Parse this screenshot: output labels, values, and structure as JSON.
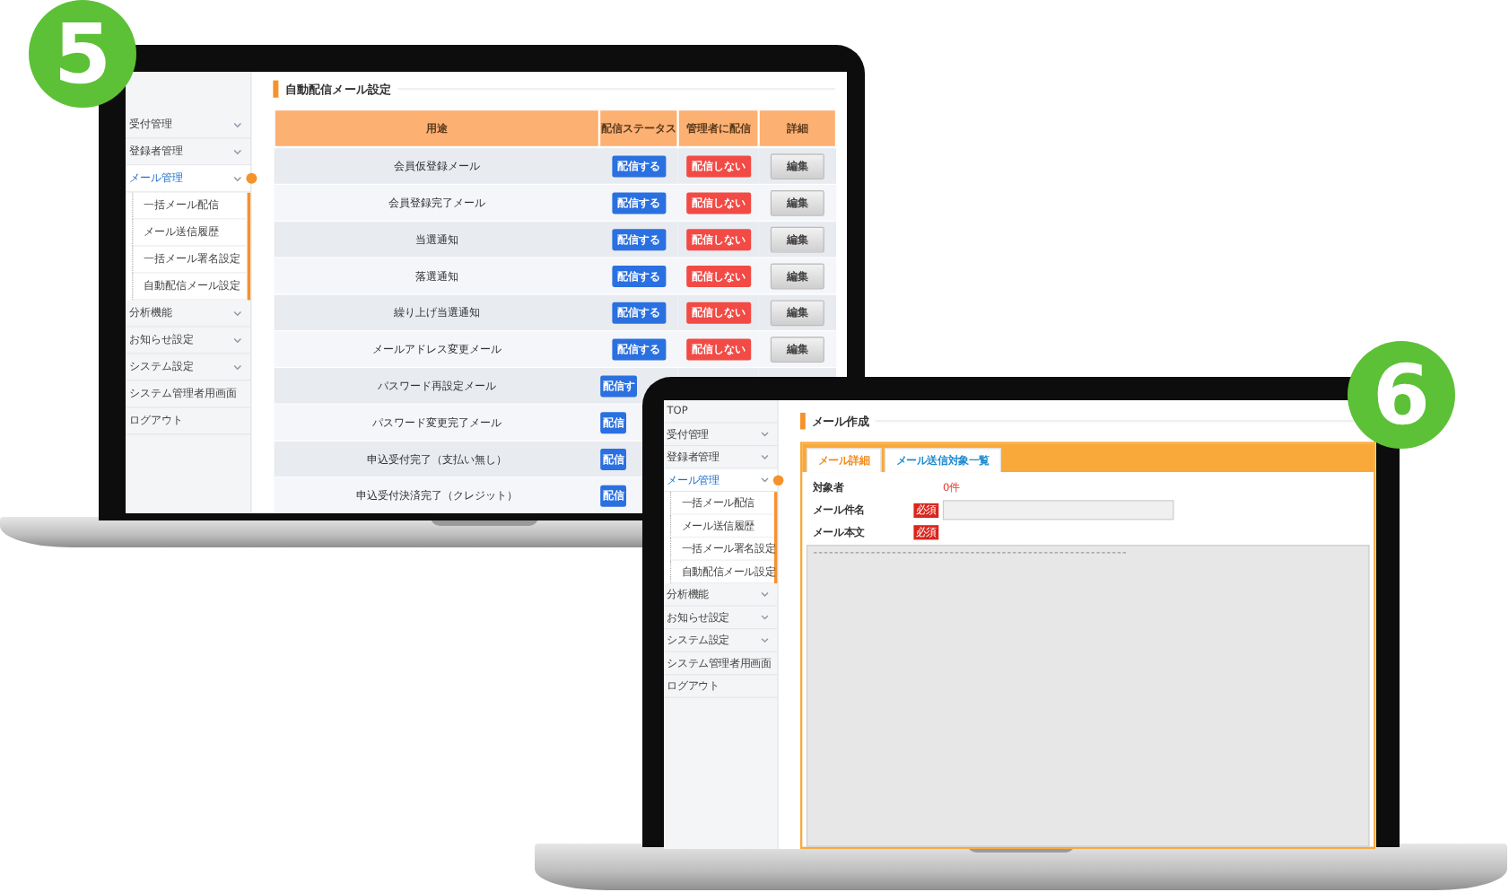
{
  "laptops": [
    {
      "kind": "table-page",
      "badge": "5",
      "sidebar": [
        {
          "label": "受付管理",
          "kind": "group",
          "selected": false
        },
        {
          "label": "登録者管理",
          "kind": "group",
          "selected": false
        },
        {
          "label": "メール管理",
          "kind": "group",
          "selected": true,
          "children": [
            {
              "label": "一括メール配信"
            },
            {
              "label": "メール送信履歴"
            },
            {
              "label": "一括メール署名設定"
            },
            {
              "label": "自動配信メール設定"
            }
          ]
        },
        {
          "label": "分析機能",
          "kind": "group",
          "selected": false
        },
        {
          "label": "お知らせ設定",
          "kind": "group",
          "selected": false
        },
        {
          "label": "システム設定",
          "kind": "group",
          "selected": false
        },
        {
          "label": "システム管理者用画面",
          "kind": "link",
          "selected": false
        },
        {
          "label": "ログアウト",
          "kind": "link",
          "selected": false
        }
      ],
      "title": "自動配信メール設定",
      "table": {
        "columns": [
          "用途",
          "配信ステータス",
          "管理者に配信",
          "詳細"
        ],
        "rows": [
          {
            "purpose": "会員仮登録メール",
            "status": "配信する",
            "admin": "配信しない",
            "edit": "編集"
          },
          {
            "purpose": "会員登録完了メール",
            "status": "配信する",
            "admin": "配信しない",
            "edit": "編集"
          },
          {
            "purpose": "当選通知",
            "status": "配信する",
            "admin": "配信しない",
            "edit": "編集"
          },
          {
            "purpose": "落選通知",
            "status": "配信する",
            "admin": "配信しない",
            "edit": "編集"
          },
          {
            "purpose": "繰り上げ当選通知",
            "status": "配信する",
            "admin": "配信しない",
            "edit": "編集"
          },
          {
            "purpose": "メールアドレス変更メール",
            "status": "配信する",
            "admin": "配信しない",
            "edit": "編集"
          },
          {
            "purpose": "パスワード再設定メール",
            "status": "配信す"
          },
          {
            "purpose": "パスワード変更完了メール",
            "status": "配信"
          },
          {
            "purpose": "申込受付完了（支払い無し）",
            "status": "配信"
          },
          {
            "purpose": "申込受付決済完了（クレジット）",
            "status": "配信"
          }
        ]
      }
    },
    {
      "kind": "form-page",
      "badge": "6",
      "sidebar": [
        {
          "label": "TOP",
          "kind": "link",
          "selected": false
        },
        {
          "label": "受付管理",
          "kind": "group",
          "selected": false
        },
        {
          "label": "登録者管理",
          "kind": "group",
          "selected": false
        },
        {
          "label": "メール管理",
          "kind": "group",
          "selected": true,
          "children": [
            {
              "label": "一括メール配信"
            },
            {
              "label": "メール送信履歴"
            },
            {
              "label": "一括メール署名設定"
            },
            {
              "label": "自動配信メール設定"
            }
          ]
        },
        {
          "label": "分析機能",
          "kind": "group",
          "selected": false
        },
        {
          "label": "お知らせ設定",
          "kind": "group",
          "selected": false
        },
        {
          "label": "システム設定",
          "kind": "group",
          "selected": false
        },
        {
          "label": "システム管理者用画面",
          "kind": "link",
          "selected": false
        },
        {
          "label": "ログアウト",
          "kind": "link",
          "selected": false
        }
      ],
      "title": "メール作成",
      "tabs": [
        {
          "label": "メール詳細",
          "selected": true
        },
        {
          "label": "メール送信対象一覧",
          "selected": false
        }
      ],
      "fields": [
        {
          "kind": "count",
          "label": "対象者",
          "value": "0件"
        },
        {
          "kind": "input",
          "label": "メール件名",
          "required": "必須"
        },
        {
          "kind": "textarea",
          "label": "メール本文",
          "required": "必須"
        }
      ]
    }
  ]
}
